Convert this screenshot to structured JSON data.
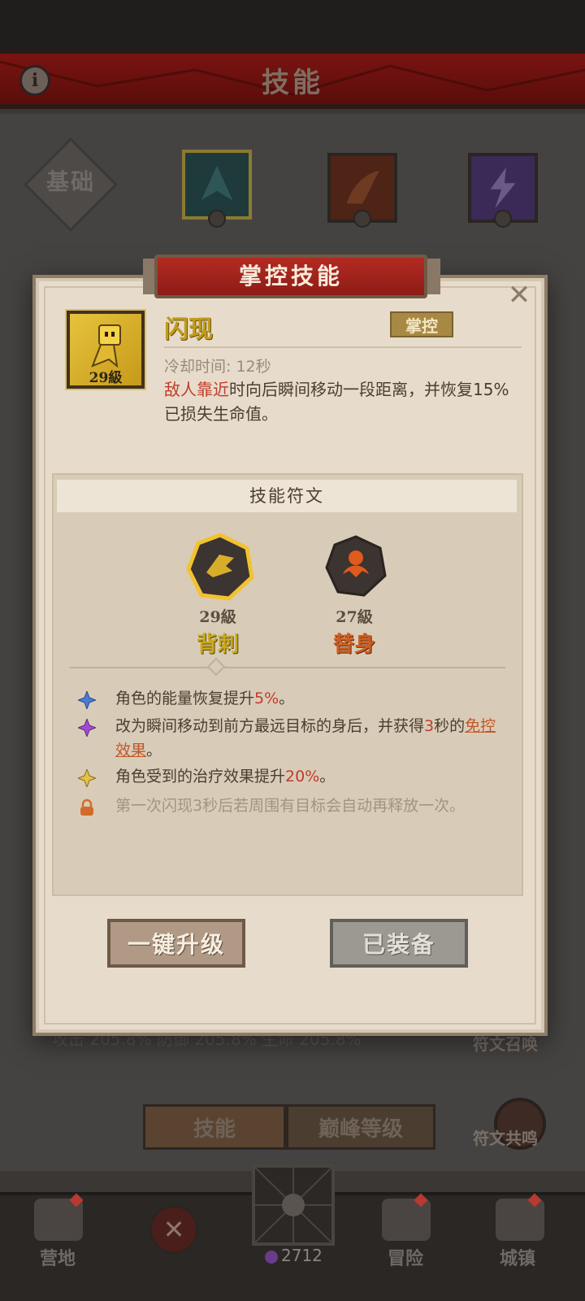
{
  "header": {
    "title": "技能"
  },
  "tabs": {
    "base": "基础"
  },
  "bottom_tabs": {
    "skills": "技能",
    "peak": "巅峰等级"
  },
  "side_buttons": {
    "rune_summon": "符文召唤",
    "rune_resonance": "符文共鸣"
  },
  "stats_line": "攻击 205.8%   防御 205.8%   生命 205.8%",
  "nav": {
    "camp": "营地",
    "adventure": "冒险",
    "town": "城镇",
    "currency": "2712"
  },
  "modal": {
    "banner": "掌控技能",
    "skill": {
      "name": "闪现",
      "level": "29級",
      "type": "掌控",
      "cooldown": "冷却时间: 12秒",
      "desc_highlight": "敌人靠近",
      "desc_rest": "时向后瞬间移动一段距离，并恢复15%已损失生命值。"
    },
    "runes_title": "技能符文",
    "runes": [
      {
        "level": "29級",
        "name": "背刺"
      },
      {
        "level": "27級",
        "name": "替身"
      }
    ],
    "effects": [
      {
        "pre": "角色的能量恢复提升",
        "value": "5%",
        "post": "。"
      },
      {
        "pre": "改为瞬间移动到前方最远目标的身后，并获得",
        "value": "3",
        "mid": "秒的",
        "link": "免控效果",
        "post": "。"
      },
      {
        "pre": "角色受到的治疗效果提升",
        "value": "20%",
        "post": "。"
      },
      {
        "text": "第一次闪现3秒后若周围有目标会自动再释放一次。"
      }
    ],
    "buttons": {
      "upgrade": "一键升级",
      "equipped": "已装备"
    }
  },
  "colors": {
    "accent_red": "#b32a22",
    "highlight_red": "#c13b2b",
    "gold": "#c9a91d",
    "orange": "#d15e1f"
  }
}
